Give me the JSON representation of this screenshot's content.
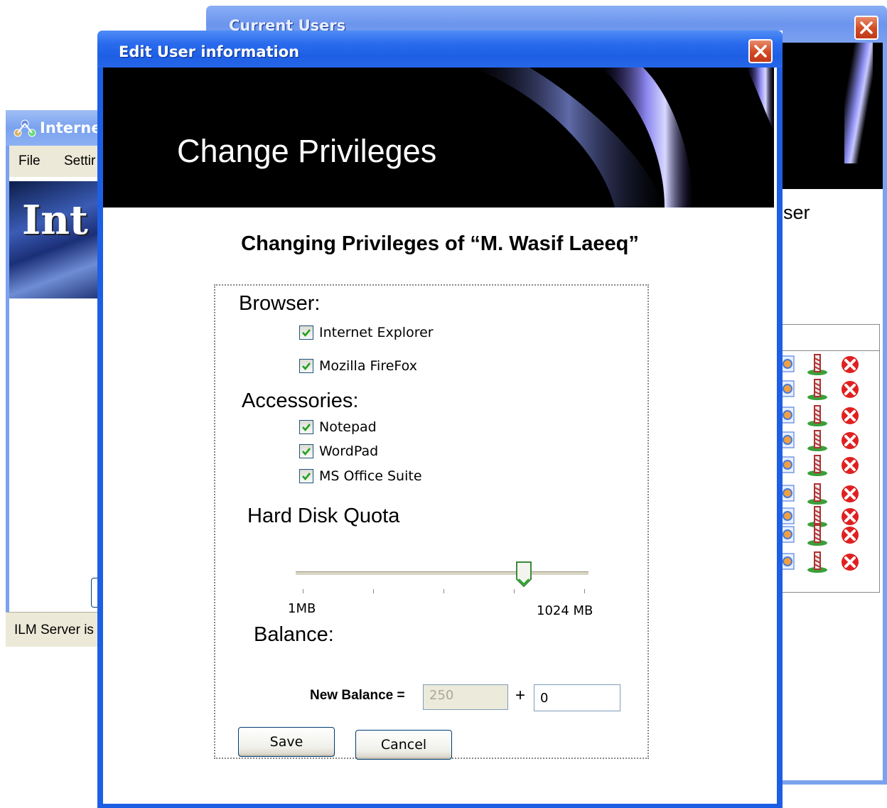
{
  "internet_window": {
    "title": "Interne",
    "menu": {
      "file": "File",
      "settings": "Settir"
    },
    "banner_text": "Int",
    "status": "ILM Server is"
  },
  "users_window": {
    "title": "Current Users",
    "peek_text": "ser"
  },
  "dialog": {
    "title": "Edit User information",
    "banner_title": "Change Privileges",
    "heading": "Changing Privileges of “M. Wasif Laeeq”",
    "browser": {
      "label": "Browser:",
      "items": [
        {
          "label": "Internet Explorer",
          "checked": true
        },
        {
          "label": "Mozilla FireFox",
          "checked": true
        }
      ]
    },
    "accessories": {
      "label": "Accessories:",
      "items": [
        {
          "label": "Notepad",
          "checked": true
        },
        {
          "label": "WordPad",
          "checked": true
        },
        {
          "label": "MS Office Suite",
          "checked": true
        }
      ]
    },
    "quota": {
      "label": "Hard Disk Quota",
      "min_label": "1MB",
      "max_label": "1024 MB",
      "value_fraction": 0.78
    },
    "balance": {
      "label": "Balance:",
      "new_balance_label": "New Balance =",
      "current_value": "250",
      "plus": "+",
      "add_value": "0"
    },
    "buttons": {
      "save": "Save",
      "cancel": "Cancel"
    }
  },
  "colors": {
    "title_bar": "#1d5fe4",
    "close_button": "#d04a22",
    "banner_bg": "#000000",
    "check_green": "#21a121"
  }
}
